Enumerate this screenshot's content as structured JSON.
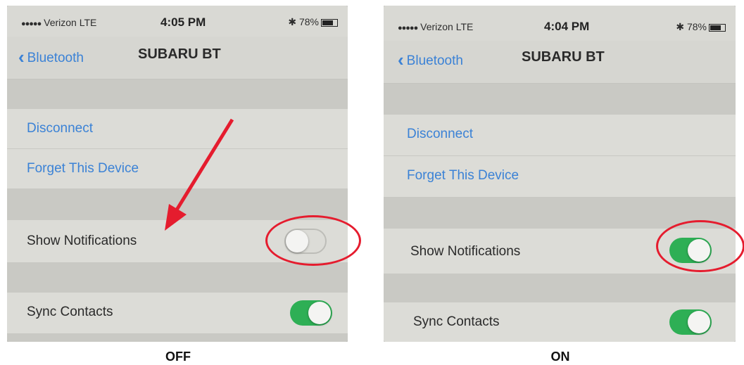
{
  "left": {
    "status": {
      "dots": "●●●●●",
      "carrier": "Verizon  LTE",
      "time": "4:05 PM",
      "battery": "78%"
    },
    "nav": {
      "back_label": "Bluetooth",
      "title": "SUBARU BT"
    },
    "actions": {
      "disconnect": "Disconnect",
      "forget": "Forget This Device"
    },
    "settings": {
      "show_notifications": {
        "label": "Show Notifications",
        "state": "off"
      },
      "sync_contacts": {
        "label": "Sync Contacts",
        "state": "on"
      }
    },
    "caption": "OFF"
  },
  "right": {
    "status": {
      "dots": "●●●●●",
      "carrier": "Verizon  LTE",
      "time": "4:04 PM",
      "battery": "78%"
    },
    "nav": {
      "back_label": "Bluetooth",
      "title": "SUBARU BT"
    },
    "actions": {
      "disconnect": "Disconnect",
      "forget": "Forget This Device"
    },
    "settings": {
      "show_notifications": {
        "label": "Show Notifications",
        "state": "on"
      },
      "sync_contacts": {
        "label": "Sync Contacts",
        "state": "on"
      }
    },
    "caption": "ON"
  },
  "colors": {
    "link_blue": "#3b82d6",
    "toggle_green": "#2eaf55",
    "annotation_red": "#e51c2e"
  }
}
